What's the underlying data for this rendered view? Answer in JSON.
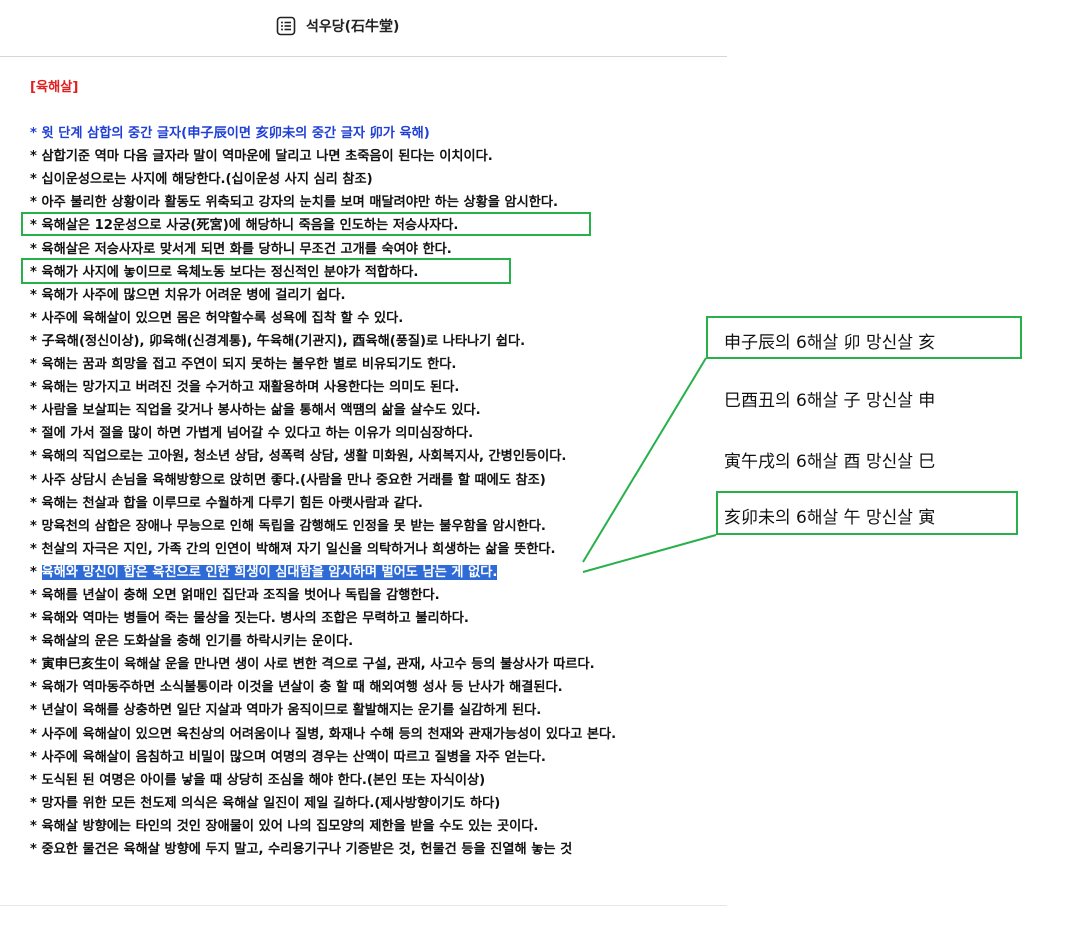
{
  "header": {
    "title": "석우당(石牛堂)",
    "icon": "list-icon"
  },
  "article": {
    "title": "[육해살]",
    "lines": [
      "* 삼합기준 역마 다음 글자라 말이 역마운에 달리고 나면 초죽음이 된다는 이치이다.",
      "* 십이운성으로는 사지에 해당한다.(십이운성 사지 심리 참조)",
      "* 아주 불리한 상황이라 활동도 위축되고 강자의 눈치를 보며 매달려야만 하는 상황을 암시한다.",
      "* 육해살은 12운성으로 사궁(死宮)에 해당하니 죽음을 인도하는 저승사자다.",
      "* 육해살은 저승사자로 맞서게 되면 화를 당하니 무조건 고개를 숙여야 한다.",
      "* 육해가 사지에 놓이므로 육체노동 보다는 정신적인 분야가 적합하다.",
      "* 육해가 사주에 많으면 치유가 어려운 병에 걸리기 쉽다.",
      "* 사주에 육해살이 있으면 몸은 허약할수록 성욕에 집착 할 수 있다.",
      "* 子육해(정신이상), 卯육해(신경계통), 午육해(기관지), 酉육해(풍질)로 나타나기 쉽다.",
      "* 육해는 꿈과 희망을 접고 주연이 되지 못하는 불우한 별로 비유되기도 한다.",
      "* 육해는 망가지고 버려진 것을 수거하고 재활용하며 사용한다는 의미도 된다.",
      "* 사람을 보살피는 직업을 갖거나 봉사하는 삶을 통해서 액땜의 삶을 살수도 있다.",
      "* 절에 가서 절을 많이 하면 가볍게 넘어갈 수 있다고 하는 이유가 의미심장하다.",
      "* 육해의 직업으로는 고아원, 청소년 상담, 성폭력 상담, 생활 미화원, 사회복지사, 간병인등이다.",
      "* 사주 상담시 손님을 육해방향으로 앉히면 좋다.(사람을 만나 중요한 거래를 할 때에도 참조)",
      "* 육해는 천살과 합을 이루므로 수월하게 다루기 힘든 아랫사람과 같다.",
      "* 망육천의 삼합은 장애나 무능으로 인해 독립을 감행해도 인정을 못 받는 불우함을 암시한다.",
      "* 천살의 자극은 지인, 가족 간의 인연이 박해져 자기 일신을 의탁하거나 희생하는 삶을 뜻한다.",
      "* 육해를 년살이 충해 오면 얽매인 집단과 조직을 벗어나 독립을 감행한다.",
      "* 육해와 역마는 병들어 죽는 물상을 짓는다. 병사의 조합은 무력하고 불리하다.",
      "* 육해살의 운은 도화살을 충해 인기를 하락시키는 운이다.",
      "* 寅申巳亥生이 육해살 운을 만나면 생이 사로 변한 격으로 구설, 관재, 사고수 등의 불상사가 따르다.",
      "* 육해가 역마동주하면 소식불통이라 이것을 년살이 충 할 때 해외여행 성사 등 난사가 해결된다.",
      "* 년살이 육해를 상충하면 일단 지살과 역마가 움직이므로 활발해지는 운기를 실감하게 된다.",
      "* 사주에 육해살이 있으면 육친상의 어려움이나 질병, 화재나 수해 등의 천재와 관재가능성이 있다고 본다.",
      "* 사주에 육해살이 음침하고 비밀이 많으며 여명의 경우는 산액이 따르고 질병을 자주 얻는다.",
      "* 도식된 된 여명은 아이를 낳을 때 상당히 조심을 해야 한다.(본인 또는 자식이상)",
      "* 망자를 위한 모든 천도제 의식은 육해살 일진이 제일 길하다.(제사방향이기도 하다)",
      "* 육해살 방향에는 타인의 것인 장애물이 있어 나의 집모양의 제한을 받을 수도 있는 곳이다.",
      "* 중요한 물건은 육해살 방향에 두지 말고, 수리용기구나 기증받은 것, 헌물건 등을 진열해 놓는 것"
    ],
    "blue_line": "* 윗 단계 삼합의 중간 글자(申子辰이면 亥卯未의 중간 글자 卯가 육해)",
    "selected_prefix": "* ",
    "selected_text": "육해와 망신이 합은 육친으로 인한 희생이 심대함을 암시하며 벌어도 남는 게 없다."
  },
  "notes": [
    "申子辰의 6해살 卯   망신살 亥",
    "巳酉丑의 6해살 子   망신살 申",
    "寅午戌의 6해살 酉   망신살 巳",
    "亥卯未의 6해살 午   망신살 寅"
  ],
  "colors": {
    "title_red": "#e02020",
    "blue_text": "#1f3fd6",
    "selection": "#2e6bd6",
    "annotation_green": "#28b04a"
  }
}
